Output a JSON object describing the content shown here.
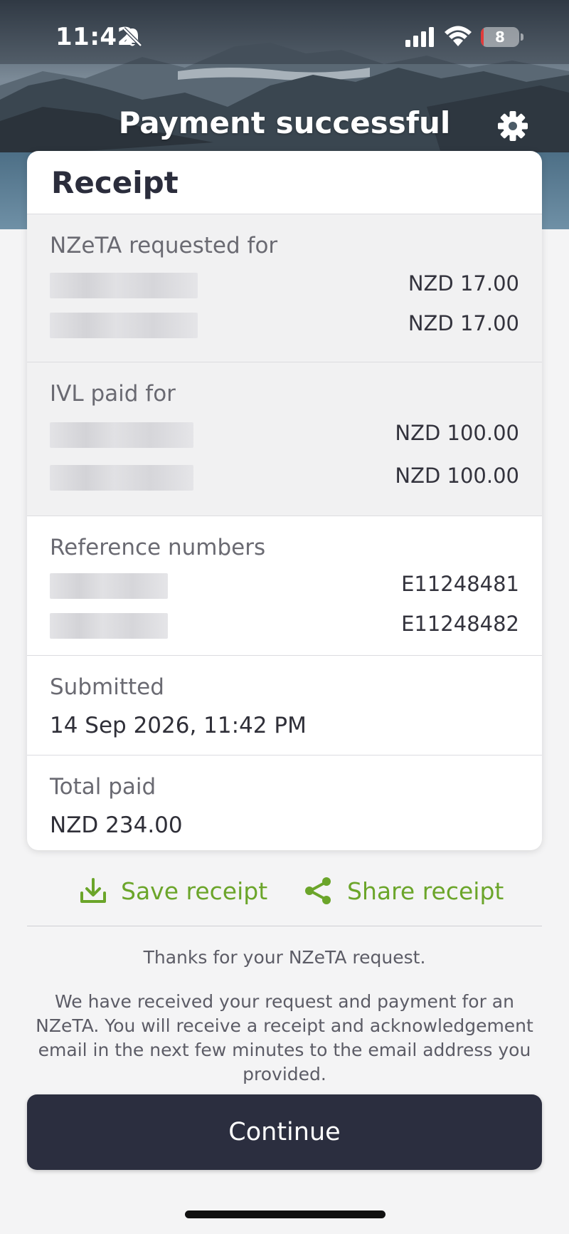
{
  "status_bar": {
    "time": "11:42",
    "battery_level": "8",
    "battery_fraction": 0.08
  },
  "header": {
    "title": "Payment successful",
    "settings_icon": "gear-icon"
  },
  "receipt": {
    "title": "Receipt",
    "nzeta": {
      "label": "NZeTA requested for",
      "amounts": [
        "NZD 17.00",
        "NZD 17.00"
      ]
    },
    "ivl": {
      "label": "IVL paid for",
      "amounts": [
        "NZD 100.00",
        "NZD 100.00"
      ]
    },
    "references": {
      "label": "Reference numbers",
      "numbers": [
        "E11248481",
        "E11248482"
      ]
    },
    "submitted": {
      "label": "Submitted",
      "value": "14 Sep 2026, 11:42 PM"
    },
    "total": {
      "label": "Total paid",
      "value": "NZD 234.00"
    }
  },
  "actions": {
    "save_label": "Save receipt",
    "share_label": "Share receipt",
    "accent_color": "#6ba52a"
  },
  "message": {
    "thanks": "Thanks for your NZeTA request.",
    "body": "We have received your request and payment for an NZeTA. You will receive a receipt and acknowledgement email in the next few minutes to the email address you provided."
  },
  "continue_label": "Continue",
  "colors": {
    "primary_button": "#2b2e3f",
    "accent_green": "#6ba52a"
  }
}
